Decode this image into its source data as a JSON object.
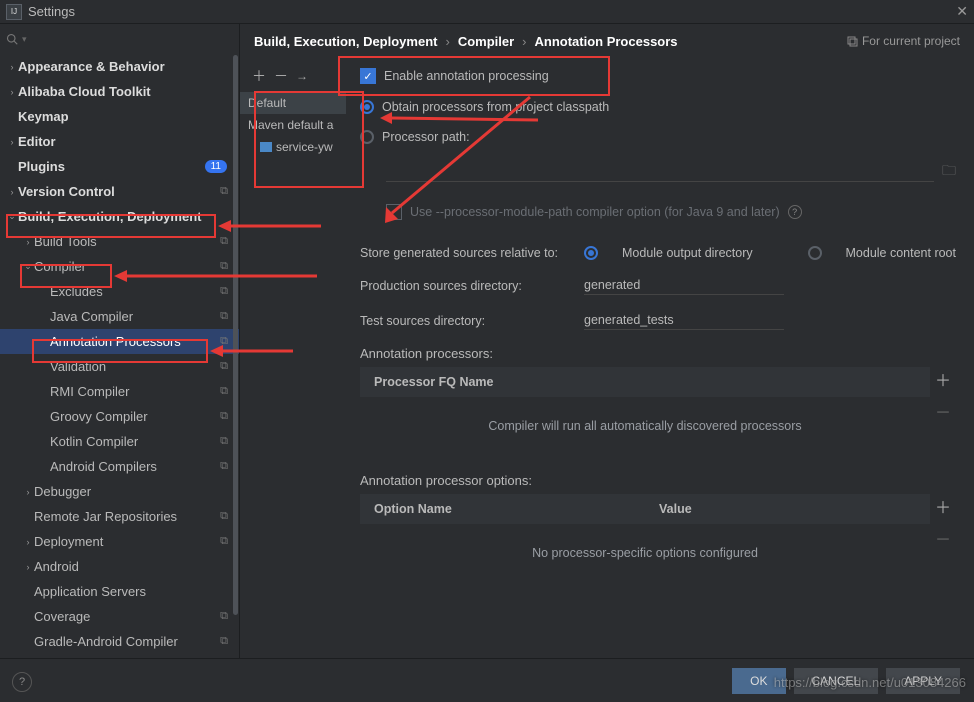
{
  "window": {
    "title": "Settings"
  },
  "breadcrumbs": {
    "a": "Build, Execution, Deployment",
    "b": "Compiler",
    "c": "Annotation Processors",
    "for_project": "For current project"
  },
  "sidebar": {
    "items": [
      {
        "label": "Appearance & Behavior",
        "depth": 0,
        "chev": ">",
        "bold": true
      },
      {
        "label": "Alibaba Cloud Toolkit",
        "depth": 0,
        "chev": ">",
        "bold": true
      },
      {
        "label": "Keymap",
        "depth": 0,
        "chev": "",
        "bold": true
      },
      {
        "label": "Editor",
        "depth": 0,
        "chev": ">",
        "bold": true
      },
      {
        "label": "Plugins",
        "depth": 0,
        "chev": "",
        "bold": true,
        "badge": "11"
      },
      {
        "label": "Version Control",
        "depth": 0,
        "chev": ">",
        "bold": true,
        "tag": true
      },
      {
        "label": "Build, Execution, Deployment",
        "depth": 0,
        "chev": "v",
        "bold": true,
        "red": true
      },
      {
        "label": "Build Tools",
        "depth": 1,
        "chev": ">",
        "tag": true
      },
      {
        "label": "Compiler",
        "depth": 1,
        "chev": "v",
        "tag": true,
        "red": true
      },
      {
        "label": "Excludes",
        "depth": 2,
        "chev": "",
        "tag": true
      },
      {
        "label": "Java Compiler",
        "depth": 2,
        "chev": "",
        "tag": true
      },
      {
        "label": "Annotation Processors",
        "depth": 2,
        "chev": "",
        "tag": true,
        "red": true,
        "sel": true
      },
      {
        "label": "Validation",
        "depth": 2,
        "chev": "",
        "tag": true
      },
      {
        "label": "RMI Compiler",
        "depth": 2,
        "chev": "",
        "tag": true
      },
      {
        "label": "Groovy Compiler",
        "depth": 2,
        "chev": "",
        "tag": true
      },
      {
        "label": "Kotlin Compiler",
        "depth": 2,
        "chev": "",
        "tag": true
      },
      {
        "label": "Android Compilers",
        "depth": 2,
        "chev": "",
        "tag": true
      },
      {
        "label": "Debugger",
        "depth": 1,
        "chev": ">"
      },
      {
        "label": "Remote Jar Repositories",
        "depth": 1,
        "chev": "",
        "tag": true
      },
      {
        "label": "Deployment",
        "depth": 1,
        "chev": ">",
        "tag": true
      },
      {
        "label": "Android",
        "depth": 1,
        "chev": ">"
      },
      {
        "label": "Application Servers",
        "depth": 1,
        "chev": ""
      },
      {
        "label": "Coverage",
        "depth": 1,
        "chev": "",
        "tag": true
      },
      {
        "label": "Gradle-Android Compiler",
        "depth": 1,
        "chev": "",
        "tag": true
      }
    ]
  },
  "profiles": {
    "default": "Default",
    "maven": "Maven default a",
    "child": "service-yw"
  },
  "form": {
    "enable": "Enable annotation processing",
    "obtain": "Obtain processors from project classpath",
    "procpath": "Processor path:",
    "usemodpath": "Use --processor-module-path compiler option (for Java 9 and later)",
    "storerel": "Store generated sources relative to:",
    "modout": "Module output directory",
    "modcontent": "Module content root",
    "proddir_lbl": "Production sources directory:",
    "proddir_val": "generated",
    "testdir_lbl": "Test sources directory:",
    "testdir_val": "generated_tests",
    "annproc_lbl": "Annotation processors:",
    "fqname": "Processor FQ Name",
    "auto_discover": "Compiler will run all automatically discovered processors",
    "options_lbl": "Annotation processor options:",
    "optname": "Option Name",
    "optval": "Value",
    "no_opts": "No processor-specific options configured"
  },
  "footer": {
    "ok": "OK",
    "cancel": "CANCEL",
    "apply": "APPLY"
  },
  "watermark": "https://blog.csdn.net/u013084266"
}
